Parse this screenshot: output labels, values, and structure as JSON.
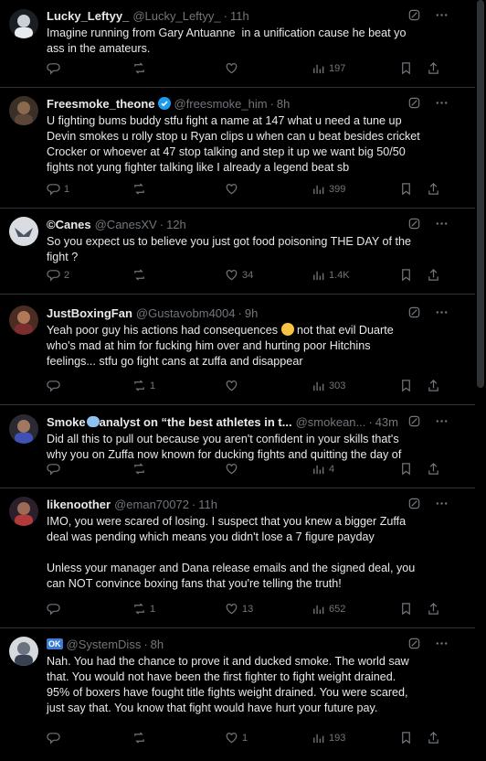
{
  "tweets": [
    {
      "name": "Lucky_Leftyy_",
      "handle": "@Lucky_Leftyy_",
      "time": "11h",
      "verified": false,
      "text": "Imagine running from Gary Antuanne  in a unification cause he beat yo\nass in the amateurs.",
      "replies": "",
      "reposts": "",
      "likes": "",
      "views": "197"
    },
    {
      "name": "Freesmoke_theone",
      "handle": "@freesmoke_him",
      "time": "8h",
      "verified": true,
      "text": "U fighting bums buddy stfu fight a name at 147 what u need a tune up\nDevin smokes u rolly stop u Ryan clips u when can u beat besides cricket\nCrocker or whoever at 47 stop talking and step it up we want big 50/50\nfights not yung fighter talking like I already a legend beat sb",
      "replies": "1",
      "reposts": "",
      "likes": "",
      "views": "399"
    },
    {
      "name": "©Canes",
      "handle": "@CanesXV",
      "time": "12h",
      "verified": false,
      "text": "So you expect us to believe you just got food poisoning THE DAY of the\nfight ?",
      "replies": "2",
      "reposts": "",
      "likes": "34",
      "views": "1.4K"
    },
    {
      "name": "JustBoxingFan",
      "handle": "@Gustavobm4004",
      "time": "9h",
      "verified": false,
      "text_a": "Yeah poor guy his actions had consequences ",
      "text_b": " not that evil Duarte\nwho's mad at him for fucking him over and hurting poor Hitchins\nfeelings... stfu go fight cans at zuffa and disappear",
      "replies": "",
      "reposts": "1",
      "likes": "",
      "views": "303"
    },
    {
      "name_a": "Smoke",
      "name_b": "analyst on “the best athletes in t...",
      "handle": "@smokean...",
      "time": "43m",
      "verified": false,
      "text": "Did all this to pull out because you aren't confident in your skills that's\nwhy you on Zuffa now known for ducking fights and quitting the day of",
      "replies": "",
      "reposts": "",
      "likes": "",
      "views": "4"
    },
    {
      "name": "likenoother",
      "handle": "@eman70072",
      "time": "11h",
      "verified": false,
      "text": "IMO, you were scared of losing. I suspect that you knew a bigger Zuffa\ndeal was pending which means you didn't lose a 7 figure payday\n\nUnless your manager and Dana release emails and the signed deal, you\ncan NOT convince boxing fans that you're telling the truth!",
      "replies": "",
      "reposts": "1",
      "likes": "13",
      "views": "652"
    },
    {
      "name_badge": "OK",
      "handle": "@SystemDiss",
      "time": "8h",
      "verified": false,
      "text": "Nah. You had the chance to prove it and ducked smoke. The world saw\nthat. You would not have been the first fighter to fight weight drained.\n95% of boxers have fought title fights weight drained. You were scared,\njust say that. You know that fight would have hurt your future pay.",
      "replies": "",
      "reposts": "",
      "likes": "1",
      "views": "193"
    }
  ],
  "icons": {
    "grok": "grok-icon",
    "more": "more-icon",
    "reply": "reply-icon",
    "repost": "repost-icon",
    "like": "like-icon",
    "views": "views-icon",
    "bookmark": "bookmark-icon",
    "share": "share-icon"
  },
  "colors": {
    "background": "#000000",
    "text": "#e7e9ea",
    "muted": "#71767b",
    "divider": "#2f3336",
    "verified": "#1d9bf0"
  }
}
